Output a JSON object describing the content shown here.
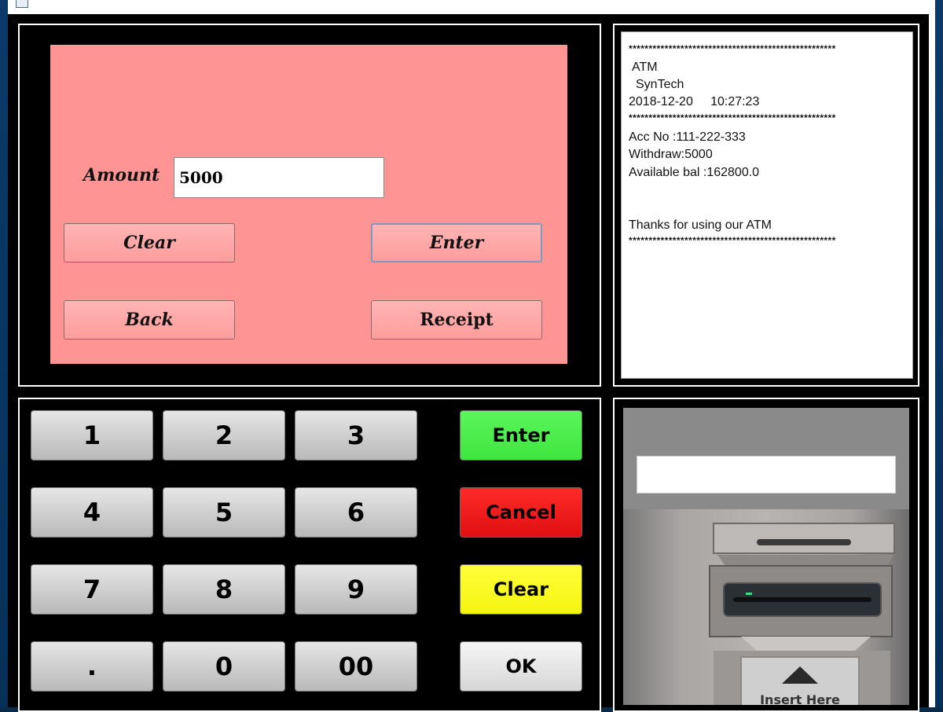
{
  "screen": {
    "amount_label": "Amount",
    "amount_value": "5000",
    "buttons": {
      "clear": "Clear",
      "enter": "Enter",
      "back": "Back",
      "receipt": "Receipt"
    },
    "background_color": "#fe9594"
  },
  "receipt": {
    "separator": "****************************************************",
    "lines": [
      "ATM",
      "SynTech",
      "2018-12-20     10:27:23",
      "Acc No :111-222-333",
      "Withdraw:5000",
      "Available bal :162800.0",
      "Thanks for using our ATM"
    ]
  },
  "keypad": {
    "keys": [
      "1",
      "2",
      "3",
      "4",
      "5",
      "6",
      "7",
      "8",
      "9",
      ".",
      "0",
      "00"
    ],
    "function_keys": [
      {
        "label": "Enter",
        "color": "#44ee44"
      },
      {
        "label": "Cancel",
        "color": "#ee1414"
      },
      {
        "label": "Clear",
        "color": "#ffff14"
      },
      {
        "label": "OK",
        "color": "#e8e8e8"
      }
    ]
  },
  "card_reader": {
    "card_input_value": "",
    "slot_caption": "Insert Here"
  }
}
